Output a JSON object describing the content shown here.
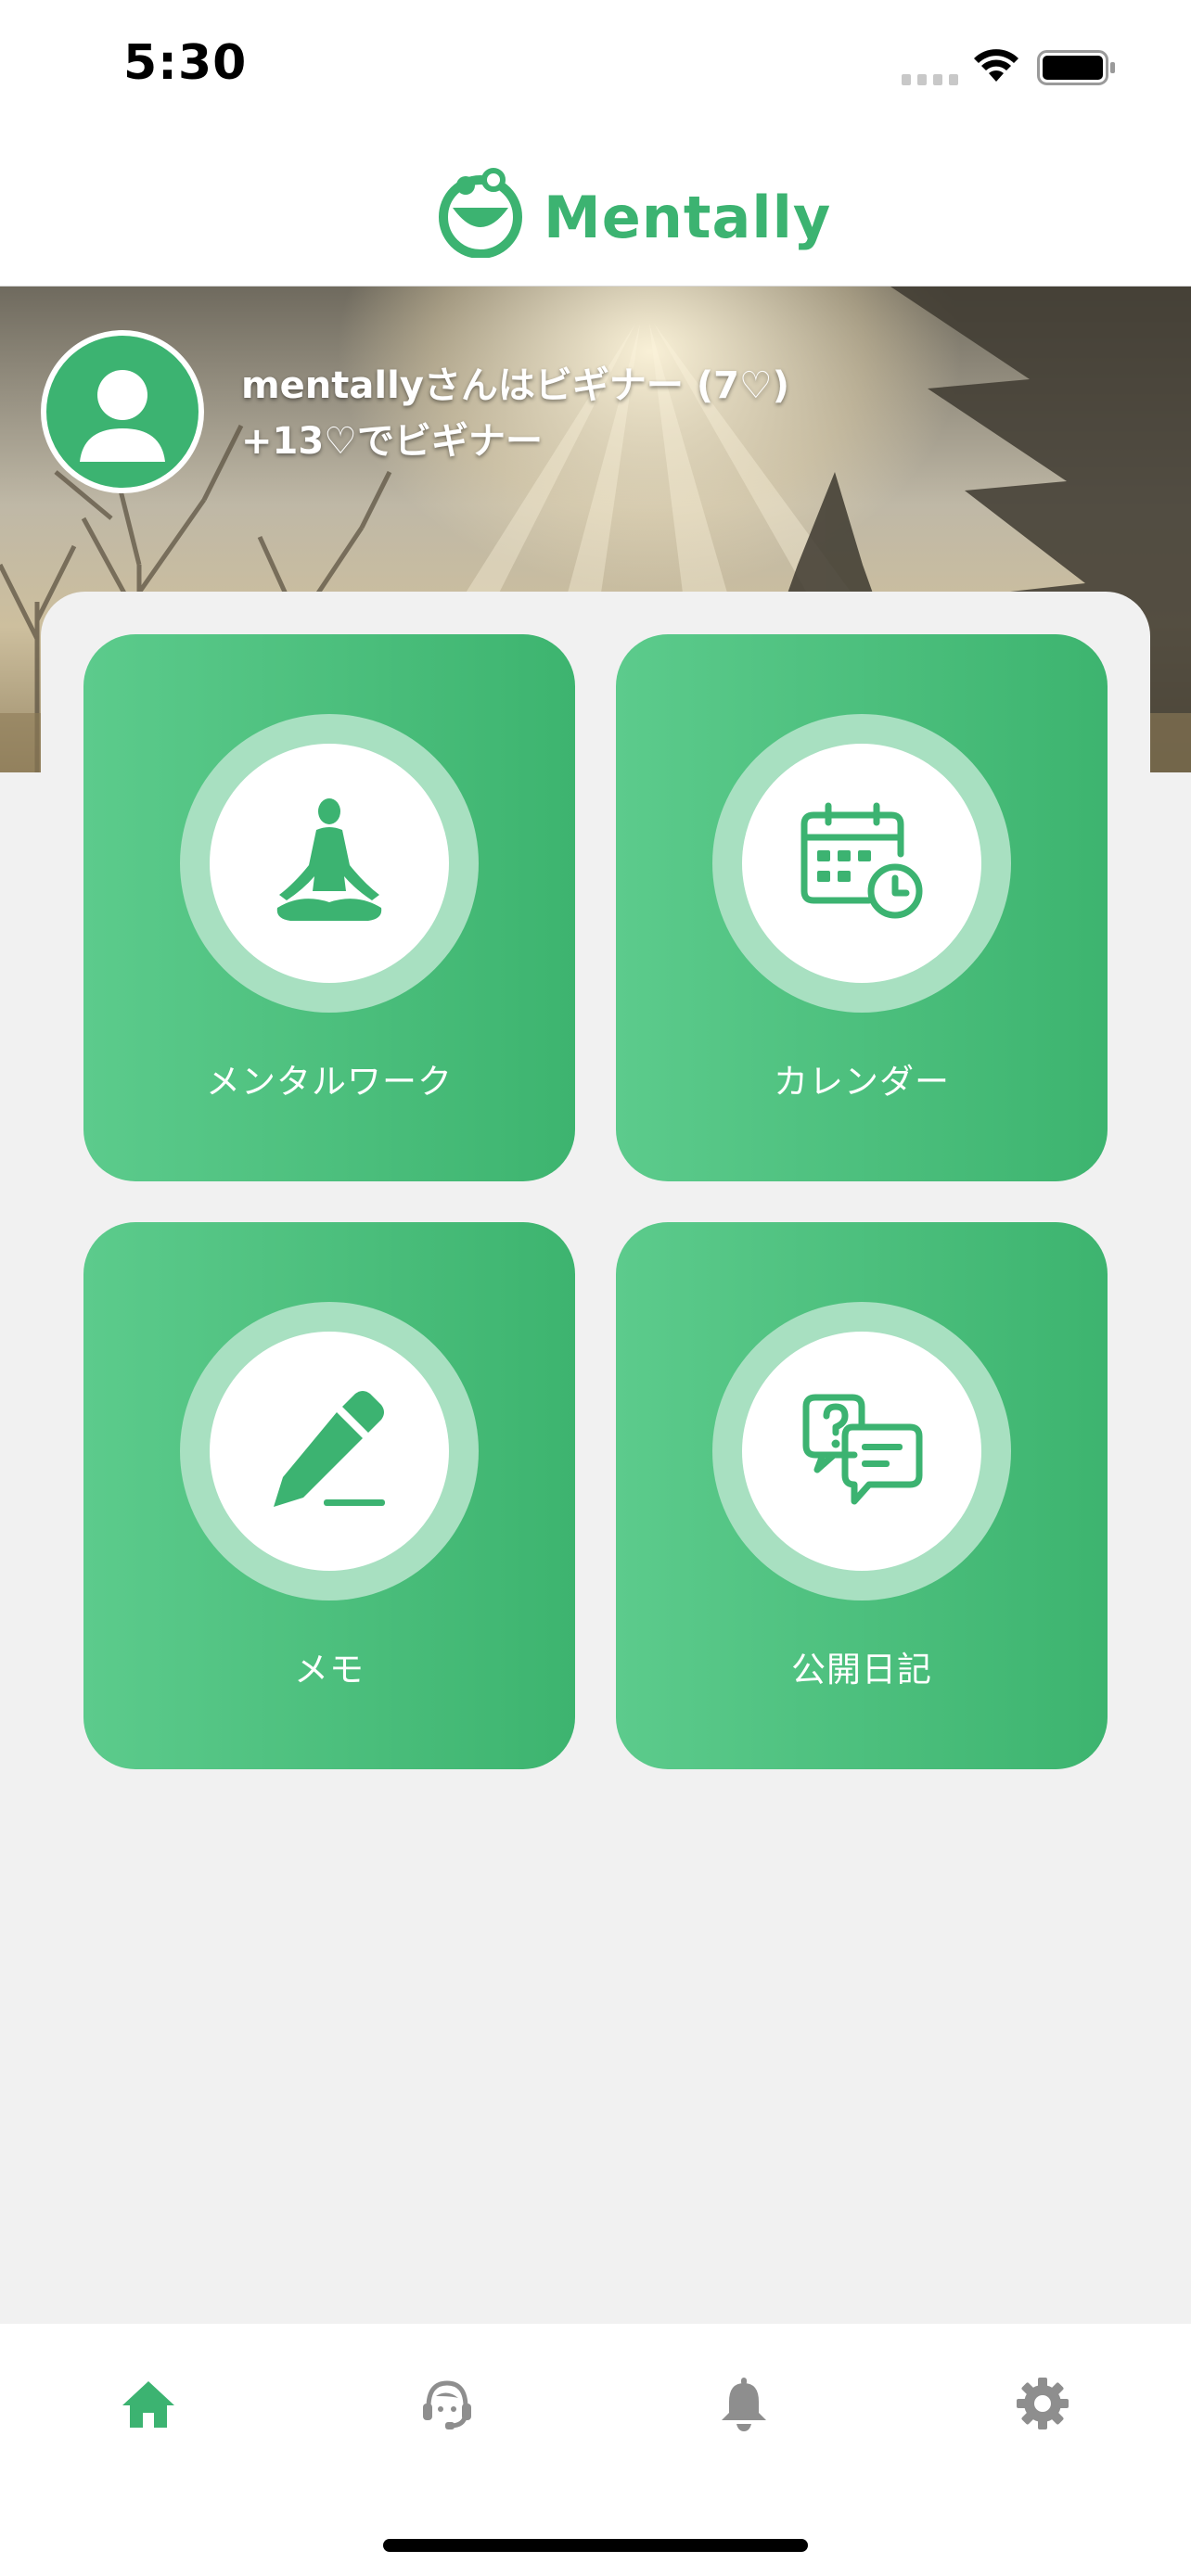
{
  "status_bar": {
    "time": "5:30",
    "icons": [
      "cellular-signal-icon",
      "wifi-icon",
      "battery-icon"
    ]
  },
  "header": {
    "logo_text": "Mentally",
    "logo_icon": "smile-logo-icon"
  },
  "profile": {
    "avatar_icon": "user-avatar-icon",
    "status_line": "mentallyさんはビギナー (7♡)",
    "next_level_line": "+13♡でビギナー"
  },
  "menu": {
    "items": [
      {
        "label": "メンタルワーク",
        "icon": "meditation-icon"
      },
      {
        "label": "カレンダー",
        "icon": "calendar-clock-icon"
      },
      {
        "label": "メモ",
        "icon": "pencil-icon"
      },
      {
        "label": "公開日記",
        "icon": "chat-bubbles-icon"
      }
    ]
  },
  "tab_bar": {
    "tabs": [
      {
        "name": "home",
        "icon": "home-icon",
        "active": true
      },
      {
        "name": "support",
        "icon": "headset-icon",
        "active": false
      },
      {
        "name": "notifications",
        "icon": "bell-icon",
        "active": false
      },
      {
        "name": "settings",
        "icon": "gear-icon",
        "active": false
      }
    ]
  },
  "colors": {
    "brand_green": "#3cb371",
    "card_gradient_start": "#5ccb8c",
    "card_gradient_end": "#3db46f",
    "ring_light_green": "#a8e0c1",
    "tab_inactive": "#8e8e8e",
    "background": "#f1f1f1"
  }
}
